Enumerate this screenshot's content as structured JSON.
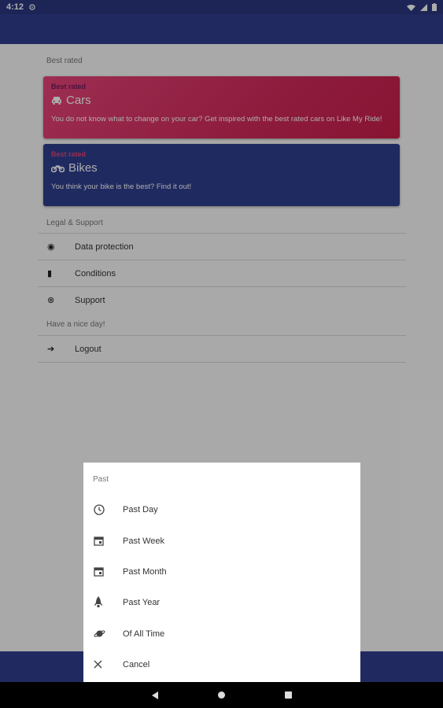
{
  "status_bar": {
    "time": "4:12",
    "gear_icon": "gear-icon",
    "wifi_icon": "wifi-icon",
    "signal_icon": "signal-icon",
    "battery_icon": "battery-icon"
  },
  "colors": {
    "primary": "#303f8f",
    "cars_card": "#d12a5b",
    "bikes_card": "#2f3e8e"
  },
  "main": {
    "best_rated_section": "Best rated",
    "cards": [
      {
        "kicker": "Best rated",
        "title": "Cars",
        "icon": "car-icon",
        "description": "You do not know what to change on your car? Get inspired with the best rated cars on Like My Ride!"
      },
      {
        "kicker": "Best rated",
        "title": "Bikes",
        "icon": "motorcycle-icon",
        "description": "You think your bike is the best? Find it out!"
      }
    ],
    "legal_section": "Legal & Support",
    "legal_items": [
      {
        "label": "Data protection",
        "icon": "user-secret-icon"
      },
      {
        "label": "Conditions",
        "icon": "document-icon"
      },
      {
        "label": "Support",
        "icon": "lifebuoy-icon"
      }
    ],
    "greeting_section": "Have a nice day!",
    "logout": {
      "label": "Logout",
      "icon": "sign-out-icon"
    }
  },
  "sheet": {
    "title": "Past",
    "items": [
      {
        "label": "Past Day",
        "icon": "clock-icon"
      },
      {
        "label": "Past Week",
        "icon": "calendar-icon"
      },
      {
        "label": "Past Month",
        "icon": "calendar-icon"
      },
      {
        "label": "Past Year",
        "icon": "rocket-icon"
      },
      {
        "label": "Of All Time",
        "icon": "planet-icon"
      },
      {
        "label": "Cancel",
        "icon": "close-icon"
      }
    ]
  }
}
